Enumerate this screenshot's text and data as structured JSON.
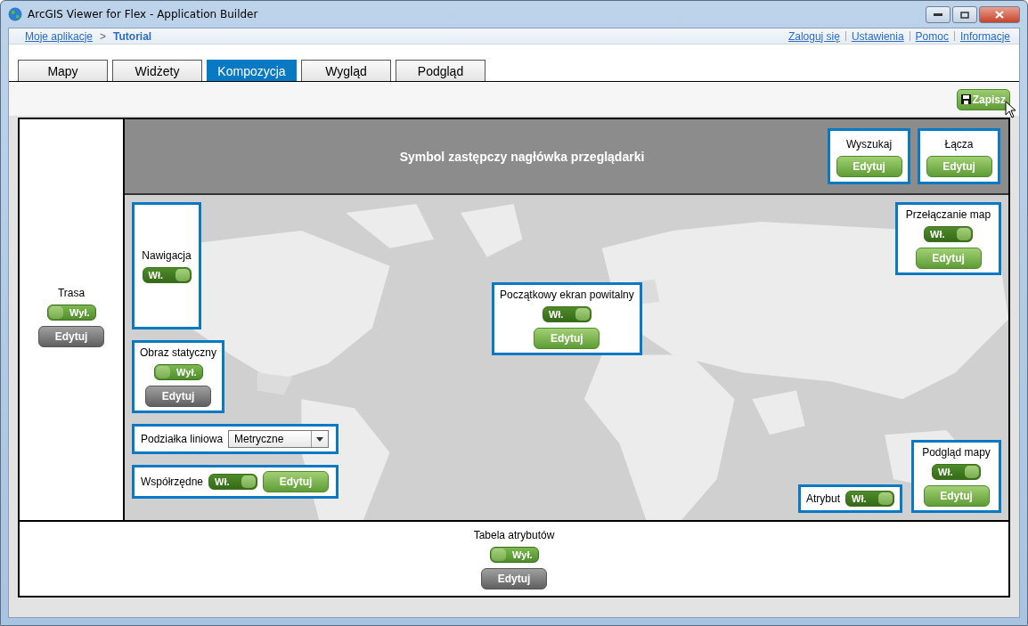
{
  "window": {
    "title": "ArcGIS Viewer for Flex - Application Builder"
  },
  "breadcrumb": {
    "link": "Moje aplikacje",
    "separator": ">",
    "current": "Tutorial"
  },
  "top_links": [
    "Zaloguj się",
    "Ustawienia",
    "Pomoc",
    "Informacje"
  ],
  "tabs": [
    {
      "label": "Mapy",
      "selected": false
    },
    {
      "label": "Widżety",
      "selected": false
    },
    {
      "label": "Kompozycja",
      "selected": true
    },
    {
      "label": "Wygląd",
      "selected": false
    },
    {
      "label": "Podgląd",
      "selected": false
    }
  ],
  "save_button": {
    "label": "Zapisz"
  },
  "left_panel": {
    "label": "Trasa",
    "toggle": {
      "label": "Wył.",
      "on": false
    },
    "edit": {
      "label": "Edytuj",
      "disabled": true
    }
  },
  "header": {
    "title": "Symbol zastępczy nagłówka przeglądarki",
    "widgets": [
      {
        "label": "Wyszukaj",
        "kind": "stack",
        "edit": {
          "label": "Edytuj",
          "disabled": false
        }
      },
      {
        "label": "Łącza",
        "kind": "stack",
        "edit": {
          "label": "Edytuj",
          "disabled": false
        }
      }
    ]
  },
  "map": {
    "kind": "picture",
    "left_widgets": [
      {
        "label": "Nawigacja",
        "kind": "stack",
        "toggle": {
          "label": "Wł.",
          "on": true
        }
      },
      {
        "label": "Obraz statyczny",
        "kind": "stack",
        "toggle": {
          "label": "Wył.",
          "on": false
        },
        "edit": {
          "label": "Edytuj",
          "disabled": true
        }
      },
      {
        "label": "Podziałka liniowa",
        "kind": "dropdown",
        "value": "Metryczne"
      },
      {
        "label": "Współrzędne",
        "kind": "inline",
        "toggle": {
          "label": "Wł.",
          "on": true
        },
        "edit": {
          "label": "Edytuj",
          "disabled": false
        }
      }
    ],
    "center_widgets": [
      {
        "label": "Początkowy ekran powitalny",
        "kind": "stack",
        "toggle": {
          "label": "Wł.",
          "on": true
        },
        "edit": {
          "label": "Edytuj",
          "disabled": false
        }
      }
    ],
    "top_right_widgets": [
      {
        "label": "Przełączanie map",
        "kind": "stack",
        "toggle": {
          "label": "Wł.",
          "on": true
        },
        "edit": {
          "label": "Edytuj",
          "disabled": false
        }
      }
    ],
    "bottom_right_widgets": [
      {
        "label": "Atrybut",
        "kind": "inline",
        "toggle": {
          "label": "Wł.",
          "on": true
        }
      },
      {
        "label": "Podgląd mapy",
        "kind": "stack",
        "toggle": {
          "label": "Wł.",
          "on": true
        },
        "edit": {
          "label": "Edytuj",
          "disabled": false
        }
      }
    ]
  },
  "bottom_panel": {
    "label": "Tabela atrybutów",
    "toggle": {
      "label": "Wył.",
      "on": false
    },
    "edit": {
      "label": "Edytuj",
      "disabled": true
    }
  }
}
